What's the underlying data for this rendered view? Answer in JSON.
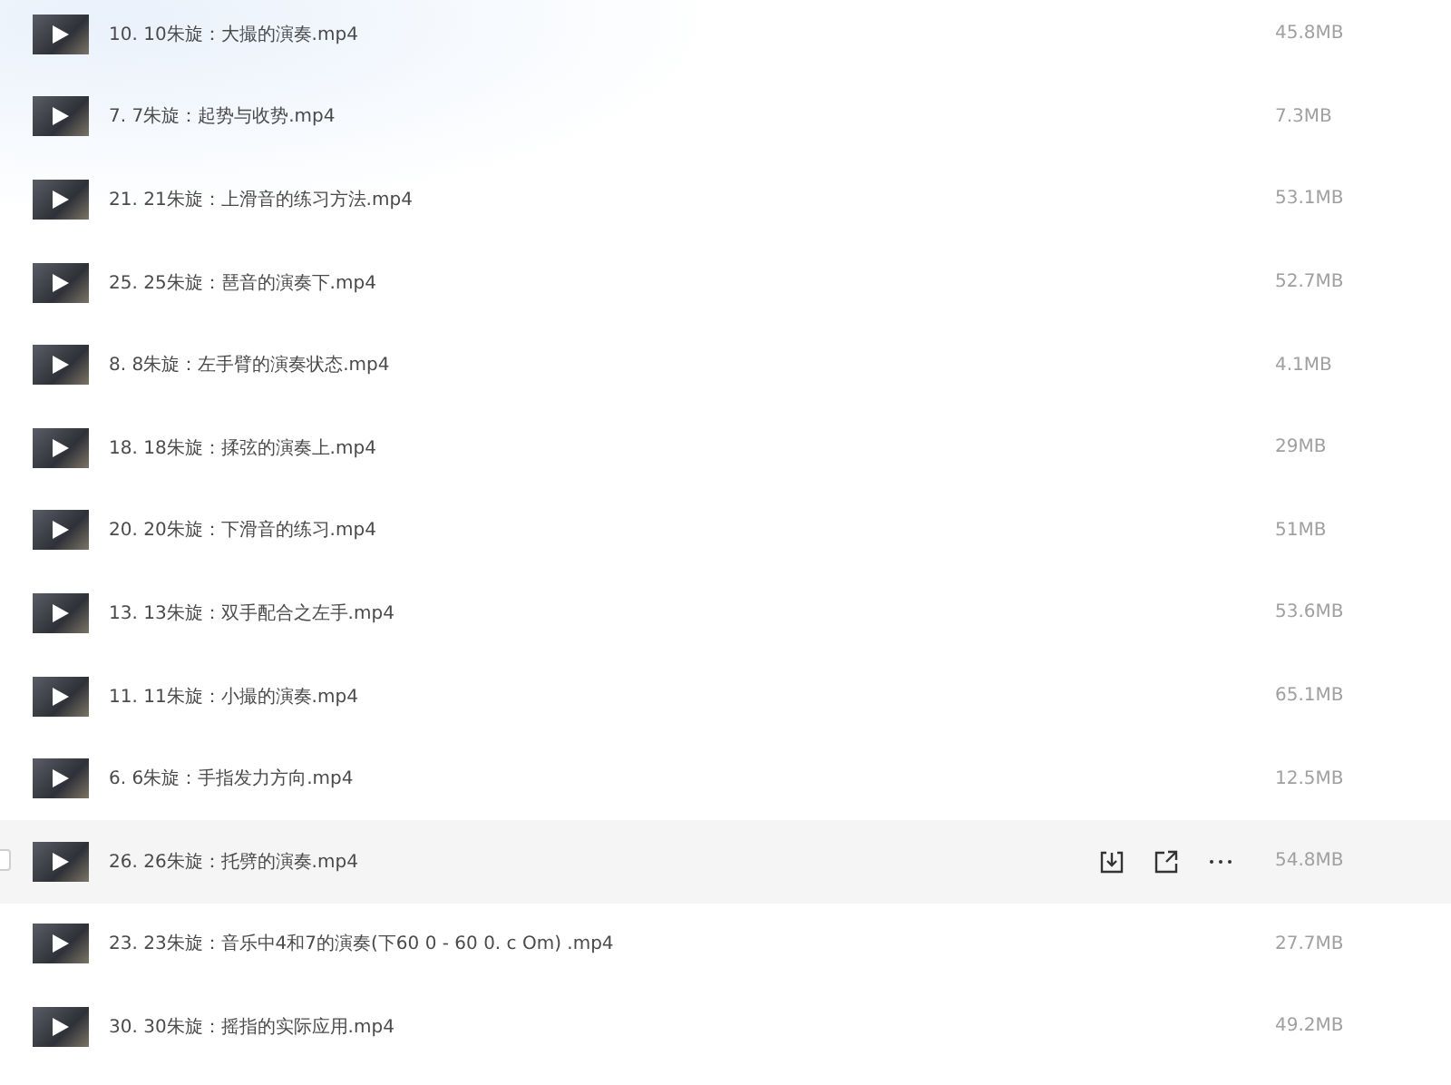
{
  "files": [
    {
      "name": "10. 10朱旋：大撮的演奏.mp4",
      "size": "45.8MB",
      "hovered": false
    },
    {
      "name": "7. 7朱旋：起势与收势.mp4",
      "size": "7.3MB",
      "hovered": false
    },
    {
      "name": "21. 21朱旋：上滑音的练习方法.mp4",
      "size": "53.1MB",
      "hovered": false
    },
    {
      "name": "25. 25朱旋：琶音的演奏下.mp4",
      "size": "52.7MB",
      "hovered": false
    },
    {
      "name": "8. 8朱旋：左手臂的演奏状态.mp4",
      "size": "4.1MB",
      "hovered": false
    },
    {
      "name": "18. 18朱旋：揉弦的演奏上.mp4",
      "size": "29MB",
      "hovered": false
    },
    {
      "name": "20. 20朱旋：下滑音的练习.mp4",
      "size": "51MB",
      "hovered": false
    },
    {
      "name": "13. 13朱旋：双手配合之左手.mp4",
      "size": "53.6MB",
      "hovered": false
    },
    {
      "name": "11. 11朱旋：小撮的演奏.mp4",
      "size": "65.1MB",
      "hovered": false
    },
    {
      "name": "6. 6朱旋：手指发力方向.mp4",
      "size": "12.5MB",
      "hovered": false
    },
    {
      "name": "26. 26朱旋：托劈的演奏.mp4",
      "size": "54.8MB",
      "hovered": true
    },
    {
      "name": "23. 23朱旋：音乐中4和7的演奏(下60 0 - 60 0. c Om) .mp4",
      "size": "27.7MB",
      "hovered": false
    },
    {
      "name": "30. 30朱旋：摇指的实际应用.mp4",
      "size": "49.2MB",
      "hovered": false
    }
  ]
}
